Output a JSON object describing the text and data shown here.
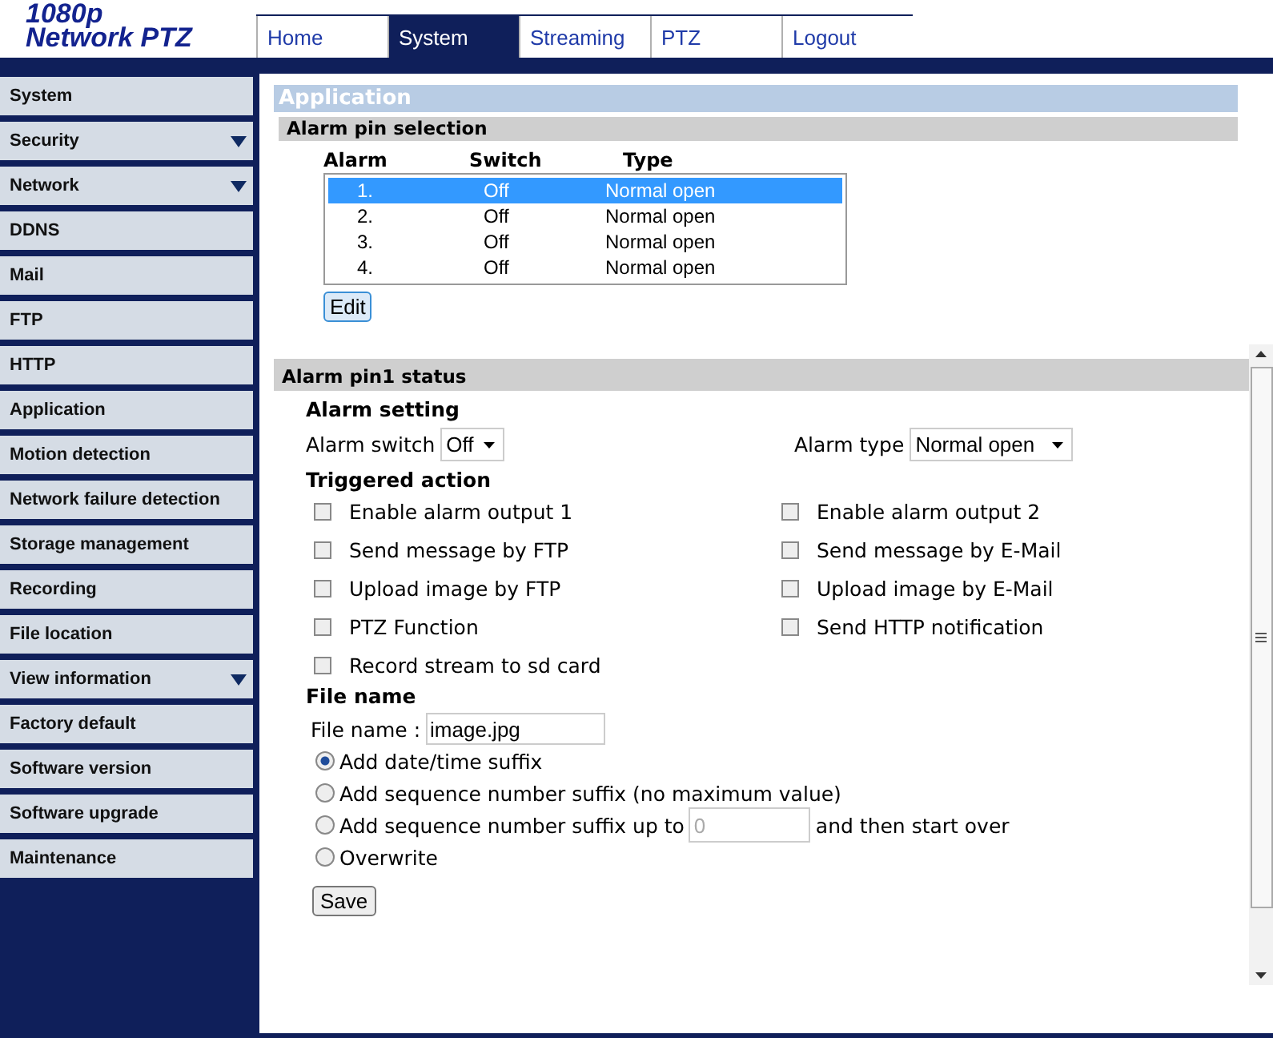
{
  "logo": {
    "line1": "1080p",
    "line2": "Network PTZ"
  },
  "tabs": [
    {
      "label": "Home",
      "selected": false
    },
    {
      "label": "System",
      "selected": true
    },
    {
      "label": "Streaming",
      "selected": false
    },
    {
      "label": "PTZ",
      "selected": false
    },
    {
      "label": "Logout",
      "selected": false
    }
  ],
  "sidebar": {
    "items": [
      {
        "label": "System",
        "has_submenu": false
      },
      {
        "label": "Security",
        "has_submenu": true
      },
      {
        "label": "Network",
        "has_submenu": true
      },
      {
        "label": "DDNS",
        "has_submenu": false
      },
      {
        "label": "Mail",
        "has_submenu": false
      },
      {
        "label": "FTP",
        "has_submenu": false
      },
      {
        "label": "HTTP",
        "has_submenu": false
      },
      {
        "label": "Application",
        "has_submenu": false
      },
      {
        "label": "Motion detection",
        "has_submenu": false
      },
      {
        "label": "Network failure detection",
        "has_submenu": false
      },
      {
        "label": "Storage management",
        "has_submenu": false
      },
      {
        "label": "Recording",
        "has_submenu": false
      },
      {
        "label": "File location",
        "has_submenu": false
      },
      {
        "label": "View information",
        "has_submenu": true
      },
      {
        "label": "Factory default",
        "has_submenu": false
      },
      {
        "label": "Software version",
        "has_submenu": false
      },
      {
        "label": "Software upgrade",
        "has_submenu": false
      },
      {
        "label": "Maintenance",
        "has_submenu": false
      }
    ]
  },
  "page_title": "Application",
  "alarm_pin_selection": {
    "title": "Alarm pin selection",
    "columns": [
      "Alarm",
      "Switch",
      "Type"
    ],
    "rows": [
      {
        "alarm": "1.",
        "switch": "Off",
        "type": "Normal open",
        "selected": true
      },
      {
        "alarm": "2.",
        "switch": "Off",
        "type": "Normal open",
        "selected": false
      },
      {
        "alarm": "3.",
        "switch": "Off",
        "type": "Normal open",
        "selected": false
      },
      {
        "alarm": "4.",
        "switch": "Off",
        "type": "Normal open",
        "selected": false
      }
    ],
    "edit_button": "Edit"
  },
  "status": {
    "title": "Alarm pin1 status",
    "alarm_setting": {
      "heading": "Alarm setting",
      "switch_label": "Alarm switch",
      "switch_value": "Off",
      "type_label": "Alarm type",
      "type_value": "Normal open"
    },
    "triggered_action": {
      "heading": "Triggered action",
      "left": [
        {
          "label": "Enable alarm output 1",
          "checked": false
        },
        {
          "label": "Send message by FTP",
          "checked": false
        },
        {
          "label": "Upload image by FTP",
          "checked": false
        },
        {
          "label": "PTZ Function",
          "checked": false
        },
        {
          "label": "Record stream to sd card",
          "checked": false
        }
      ],
      "right": [
        {
          "label": "Enable alarm output 2",
          "checked": false
        },
        {
          "label": "Send message by E-Mail",
          "checked": false
        },
        {
          "label": "Upload image by E-Mail",
          "checked": false
        },
        {
          "label": "Send HTTP notification",
          "checked": false
        }
      ]
    },
    "file_name": {
      "heading": "File name",
      "label": "File name :",
      "value": "image.jpg",
      "options": [
        {
          "kind": "plain",
          "label": "Add date/time suffix",
          "selected": true
        },
        {
          "kind": "plain",
          "label": "Add sequence number suffix (no maximum value)",
          "selected": false
        },
        {
          "kind": "limit",
          "label": "Add sequence number suffix up to",
          "value": "0",
          "disabled": true,
          "suffix": "and then start over",
          "selected": false
        },
        {
          "kind": "plain",
          "label": "Overwrite",
          "selected": false
        }
      ]
    },
    "save_button": "Save"
  }
}
